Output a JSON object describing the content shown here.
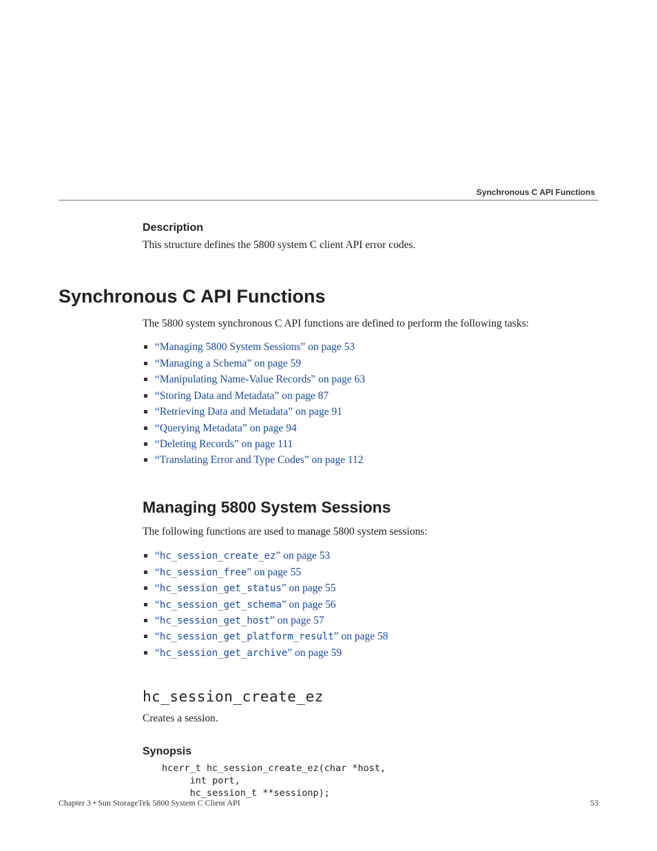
{
  "running_head": "Synchronous C API Functions",
  "description": {
    "heading": "Description",
    "text": "This structure defines the 5800 system C client API error codes."
  },
  "section": {
    "title": "Synchronous C API Functions",
    "intro": "The 5800 system synchronous C API functions are defined to perform the following tasks:",
    "links": [
      {
        "label": "“Managing 5800 System Sessions” on page 53"
      },
      {
        "label": "“Managing a Schema” on page 59"
      },
      {
        "label": "“Manipulating Name-Value Records” on page 63"
      },
      {
        "label": "“Storing Data and Metadata” on page 87"
      },
      {
        "label": "“Retrieving Data and Metadata” on page 91"
      },
      {
        "label": "“Querying Metadata” on page 94"
      },
      {
        "label": "“Deleting Records” on page 111"
      },
      {
        "label": "“Translating Error and Type Codes” on page 112"
      }
    ]
  },
  "subsection": {
    "title": "Managing 5800 System Sessions",
    "intro": "The following functions are used to manage 5800 system sessions:",
    "items": [
      {
        "code": "hc_session_create_ez",
        "suffix": " on page 53"
      },
      {
        "code": "hc_session_free",
        "suffix": " on page 55"
      },
      {
        "code": "hc_session_get_status",
        "suffix": " on page 55"
      },
      {
        "code": "hc_session_get_schema",
        "suffix": " on page 56"
      },
      {
        "code": "hc_session_get_host",
        "suffix": " on page 57"
      },
      {
        "code": "hc_session_get_platform_result",
        "suffix": " on page 58"
      },
      {
        "code": "hc_session_get_archive",
        "suffix": " on page 59"
      }
    ]
  },
  "func": {
    "name": "hc_session_create_ez",
    "desc": "Creates a session.",
    "syn_heading": "Synopsis",
    "synopsis": "hcerr_t hc_session_create_ez(char *host,\n     int port,\n     hc_session_t **sessionp);"
  },
  "footer": {
    "left": "Chapter 3 • Sun StorageTek 5800 System C Client API",
    "page": "53"
  }
}
